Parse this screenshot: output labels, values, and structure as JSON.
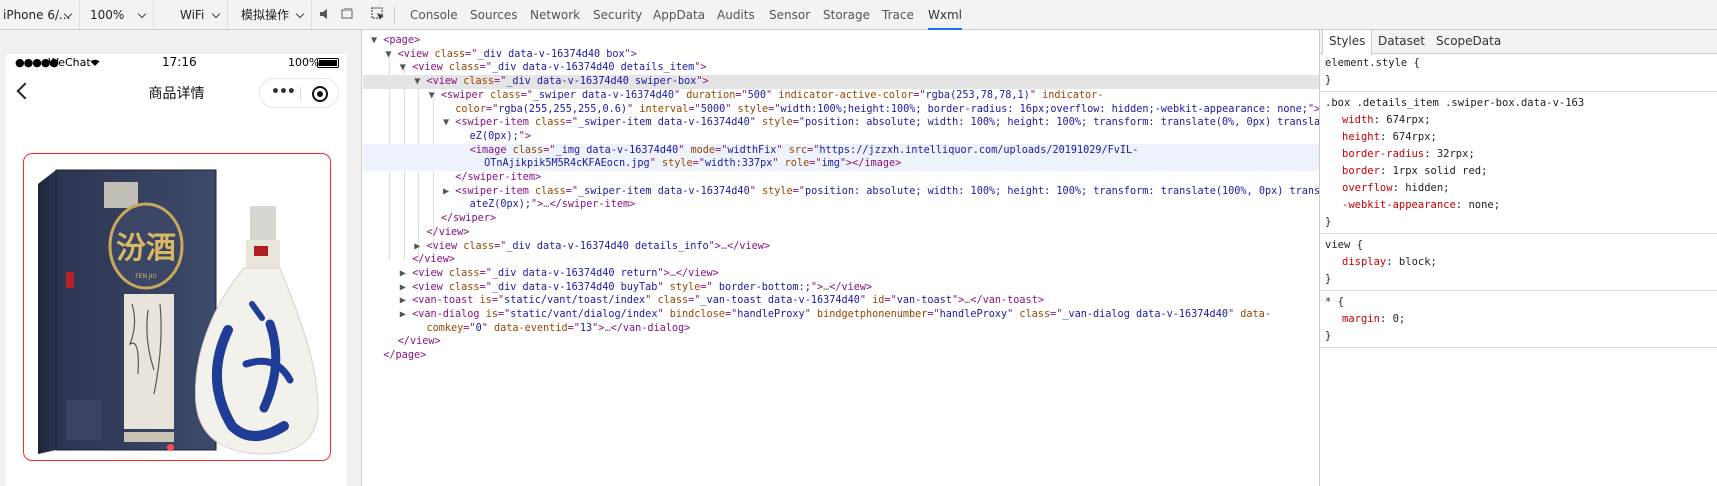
{
  "toolbar": {
    "device": "iPhone 6/...",
    "zoom": "100%",
    "network": "WiFi",
    "operation": "模拟操作",
    "tabs": [
      "Console",
      "Sources",
      "Network",
      "Security",
      "AppData",
      "Audits",
      "Sensor",
      "Storage",
      "Trace",
      "Wxml"
    ],
    "active_tab": "Wxml"
  },
  "phone": {
    "signal": "●●●●●",
    "carrier": "WeChat",
    "time": "17:16",
    "battery": "100%",
    "nav_title": "商品详情",
    "capsule_dots": "•••"
  },
  "product": {
    "box_text": "汾酒",
    "box_sub": "FEN JIU"
  },
  "wxml": {
    "colors": {
      "tag": "#881280",
      "attr_name": "#994500",
      "attr_value": "#1a1aa6"
    },
    "lines": [
      {
        "indent": 0,
        "tri": "▼",
        "parts": [
          [
            "tag",
            "<page>"
          ]
        ]
      },
      {
        "indent": 1,
        "tri": "▼",
        "parts": [
          [
            "tag",
            "<view "
          ],
          [
            "an",
            "class"
          ],
          [
            "tag",
            "=\""
          ],
          [
            "av",
            "_div data-v-16374d40 box"
          ],
          [
            "tag",
            "\">"
          ]
        ]
      },
      {
        "indent": 2,
        "tri": "▼",
        "parts": [
          [
            "tag",
            "<view "
          ],
          [
            "an",
            "class"
          ],
          [
            "tag",
            "=\""
          ],
          [
            "av",
            "_div data-v-16374d40 details_item"
          ],
          [
            "tag",
            "\">"
          ]
        ]
      },
      {
        "indent": 3,
        "tri": "▼",
        "hl": true,
        "parts": [
          [
            "tag",
            "<view "
          ],
          [
            "an",
            "class"
          ],
          [
            "tag",
            "=\""
          ],
          [
            "av",
            "_div data-v-16374d40 swiper-box"
          ],
          [
            "tag",
            "\">"
          ]
        ]
      },
      {
        "indent": 4,
        "tri": "▼",
        "parts": [
          [
            "tag",
            "<swiper "
          ],
          [
            "an",
            "class"
          ],
          [
            "tag",
            "=\""
          ],
          [
            "av",
            "_swiper data-v-16374d40"
          ],
          [
            "tag",
            "\" "
          ],
          [
            "an",
            "duration"
          ],
          [
            "tag",
            "=\""
          ],
          [
            "av",
            "500"
          ],
          [
            "tag",
            "\" "
          ],
          [
            "an",
            "indicator-active-color"
          ],
          [
            "tag",
            "=\""
          ],
          [
            "av",
            "rgba(253,78,78,1)"
          ],
          [
            "tag",
            "\" "
          ],
          [
            "an",
            "indicator-"
          ]
        ]
      },
      {
        "indent": 4,
        "tri": "",
        "parts": [
          [
            "an",
            "color"
          ],
          [
            "tag",
            "=\""
          ],
          [
            "av",
            "rgba(255,255,255,0.6)"
          ],
          [
            "tag",
            "\" "
          ],
          [
            "an",
            "interval"
          ],
          [
            "tag",
            "=\""
          ],
          [
            "av",
            "5000"
          ],
          [
            "tag",
            "\" "
          ],
          [
            "an",
            "style"
          ],
          [
            "tag",
            "=\""
          ],
          [
            "av",
            "width:100%;height:100%; border-radius: 16px;overflow: hidden;-webkit-appearance: none;"
          ],
          [
            "tag",
            "\">"
          ]
        ]
      },
      {
        "indent": 5,
        "tri": "▼",
        "parts": [
          [
            "tag",
            "<swiper-item "
          ],
          [
            "an",
            "class"
          ],
          [
            "tag",
            "=\""
          ],
          [
            "av",
            "_swiper-item data-v-16374d40"
          ],
          [
            "tag",
            "\" "
          ],
          [
            "an",
            "style"
          ],
          [
            "tag",
            "=\""
          ],
          [
            "av",
            "position: absolute; width: 100%; height: 100%; transform: translate(0%, 0px) translat"
          ]
        ]
      },
      {
        "indent": 5,
        "tri": "",
        "parts": [
          [
            "av",
            "eZ(0px);"
          ],
          [
            "tag",
            "\">"
          ]
        ]
      },
      {
        "indent": 6,
        "tri": "",
        "sel": true,
        "parts": [
          [
            "tag",
            "<image "
          ],
          [
            "an",
            "class"
          ],
          [
            "tag",
            "=\""
          ],
          [
            "av",
            "_img data-v-16374d40"
          ],
          [
            "tag",
            "\" "
          ],
          [
            "an",
            "mode"
          ],
          [
            "tag",
            "=\""
          ],
          [
            "av",
            "widthFix"
          ],
          [
            "tag",
            "\" "
          ],
          [
            "an",
            "src"
          ],
          [
            "tag",
            "=\""
          ],
          [
            "av",
            "https://jzzxh.intelliquor.com/uploads/20191029/FvIL-"
          ]
        ]
      },
      {
        "indent": 6,
        "tri": "",
        "sel": true,
        "parts": [
          [
            "av",
            "OTnAjikpik5M5R4cKFAEocn.jpg"
          ],
          [
            "tag",
            "\" "
          ],
          [
            "an",
            "style"
          ],
          [
            "tag",
            "=\""
          ],
          [
            "av",
            "width:337px"
          ],
          [
            "tag",
            "\" "
          ],
          [
            "an",
            "role"
          ],
          [
            "tag",
            "=\""
          ],
          [
            "av",
            "img"
          ],
          [
            "tag",
            "\"></image>"
          ]
        ]
      },
      {
        "indent": 5,
        "tri": "",
        "parts": [
          [
            "tag",
            "</swiper-item>"
          ]
        ]
      },
      {
        "indent": 5,
        "tri": "▶",
        "parts": [
          [
            "tag",
            "<swiper-item "
          ],
          [
            "an",
            "class"
          ],
          [
            "tag",
            "=\""
          ],
          [
            "av",
            "_swiper-item data-v-16374d40"
          ],
          [
            "tag",
            "\" "
          ],
          [
            "an",
            "style"
          ],
          [
            "tag",
            "=\""
          ],
          [
            "av",
            "position: absolute; width: 100%; height: 100%; transform: translate(100%, 0px) transl"
          ]
        ]
      },
      {
        "indent": 5,
        "tri": "",
        "parts": [
          [
            "av",
            "ateZ(0px);"
          ],
          [
            "tag",
            "\">"
          ],
          [
            "ell",
            "…"
          ],
          [
            "tag",
            "</swiper-item>"
          ]
        ]
      },
      {
        "indent": 4,
        "tri": "",
        "parts": [
          [
            "tag",
            "</swiper>"
          ]
        ]
      },
      {
        "indent": 3,
        "tri": "",
        "parts": [
          [
            "tag",
            "</view>"
          ]
        ]
      },
      {
        "indent": 3,
        "tri": "▶",
        "parts": [
          [
            "tag",
            "<view "
          ],
          [
            "an",
            "class"
          ],
          [
            "tag",
            "=\""
          ],
          [
            "av",
            "_div data-v-16374d40 details_info"
          ],
          [
            "tag",
            "\">"
          ],
          [
            "ell",
            "…"
          ],
          [
            "tag",
            "</view>"
          ]
        ]
      },
      {
        "indent": 2,
        "tri": "",
        "parts": [
          [
            "tag",
            "</view>"
          ]
        ]
      },
      {
        "indent": 2,
        "tri": "▶",
        "parts": [
          [
            "tag",
            "<view "
          ],
          [
            "an",
            "class"
          ],
          [
            "tag",
            "=\""
          ],
          [
            "av",
            "_div data-v-16374d40 return"
          ],
          [
            "tag",
            "\">"
          ],
          [
            "ell",
            "…"
          ],
          [
            "tag",
            "</view>"
          ]
        ]
      },
      {
        "indent": 2,
        "tri": "▶",
        "parts": [
          [
            "tag",
            "<view "
          ],
          [
            "an",
            "class"
          ],
          [
            "tag",
            "=\""
          ],
          [
            "av",
            "_div data-v-16374d40 buyTab"
          ],
          [
            "tag",
            "\" "
          ],
          [
            "an",
            "style"
          ],
          [
            "tag",
            "=\""
          ],
          [
            "av",
            " border-bottom:;"
          ],
          [
            "tag",
            "\">"
          ],
          [
            "ell",
            "…"
          ],
          [
            "tag",
            "</view>"
          ]
        ]
      },
      {
        "indent": 2,
        "tri": "▶",
        "parts": [
          [
            "tag",
            "<van-toast "
          ],
          [
            "an",
            "is"
          ],
          [
            "tag",
            "=\""
          ],
          [
            "av",
            "static/vant/toast/index"
          ],
          [
            "tag",
            "\" "
          ],
          [
            "an",
            "class"
          ],
          [
            "tag",
            "=\""
          ],
          [
            "av",
            "_van-toast data-v-16374d40"
          ],
          [
            "tag",
            "\" "
          ],
          [
            "an",
            "id"
          ],
          [
            "tag",
            "=\""
          ],
          [
            "av",
            "van-toast"
          ],
          [
            "tag",
            "\">"
          ],
          [
            "ell",
            "…"
          ],
          [
            "tag",
            "</van-toast>"
          ]
        ]
      },
      {
        "indent": 2,
        "tri": "▶",
        "parts": [
          [
            "tag",
            "<van-dialog "
          ],
          [
            "an",
            "is"
          ],
          [
            "tag",
            "=\""
          ],
          [
            "av",
            "static/vant/dialog/index"
          ],
          [
            "tag",
            "\" "
          ],
          [
            "an",
            "bindclose"
          ],
          [
            "tag",
            "=\""
          ],
          [
            "av",
            "handleProxy"
          ],
          [
            "tag",
            "\" "
          ],
          [
            "an",
            "bindgetphonenumber"
          ],
          [
            "tag",
            "=\""
          ],
          [
            "av",
            "handleProxy"
          ],
          [
            "tag",
            "\" "
          ],
          [
            "an",
            "class"
          ],
          [
            "tag",
            "=\""
          ],
          [
            "av",
            "_van-dialog data-v-16374d40"
          ],
          [
            "tag",
            "\" "
          ],
          [
            "an",
            "data-"
          ]
        ]
      },
      {
        "indent": 2,
        "tri": "",
        "parts": [
          [
            "an",
            "comkey"
          ],
          [
            "tag",
            "=\""
          ],
          [
            "av",
            "0"
          ],
          [
            "tag",
            "\" "
          ],
          [
            "an",
            "data-eventid"
          ],
          [
            "tag",
            "=\""
          ],
          [
            "av",
            "13"
          ],
          [
            "tag",
            "\">"
          ],
          [
            "ell",
            "…"
          ],
          [
            "tag",
            "</van-dialog>"
          ]
        ]
      },
      {
        "indent": 1,
        "tri": "",
        "parts": [
          [
            "tag",
            "</view>"
          ]
        ]
      },
      {
        "indent": 0,
        "tri": "",
        "parts": [
          [
            "tag",
            "</page>"
          ]
        ]
      }
    ]
  },
  "styles_panel": {
    "tabs": [
      "Styles",
      "Dataset",
      "ScopeData"
    ],
    "active_tab": "Styles",
    "rules": [
      {
        "selector": "element.style {",
        "props": [],
        "close": "}"
      },
      {
        "selector": ".box .details_item .swiper-box.data-v-163",
        "props": [
          [
            "width",
            "674rpx;"
          ],
          [
            "height",
            "674rpx;"
          ],
          [
            "border-radius",
            "32rpx;"
          ],
          [
            "border",
            "1rpx solid red;"
          ],
          [
            "overflow",
            "hidden;"
          ],
          [
            "-webkit-appearance",
            "none;"
          ]
        ],
        "close": "}"
      },
      {
        "selector": "view {",
        "props": [
          [
            "display",
            "block;"
          ]
        ],
        "close": "}"
      },
      {
        "selector": "* {",
        "props": [
          [
            "margin",
            "0;"
          ]
        ],
        "close": "}"
      }
    ]
  }
}
